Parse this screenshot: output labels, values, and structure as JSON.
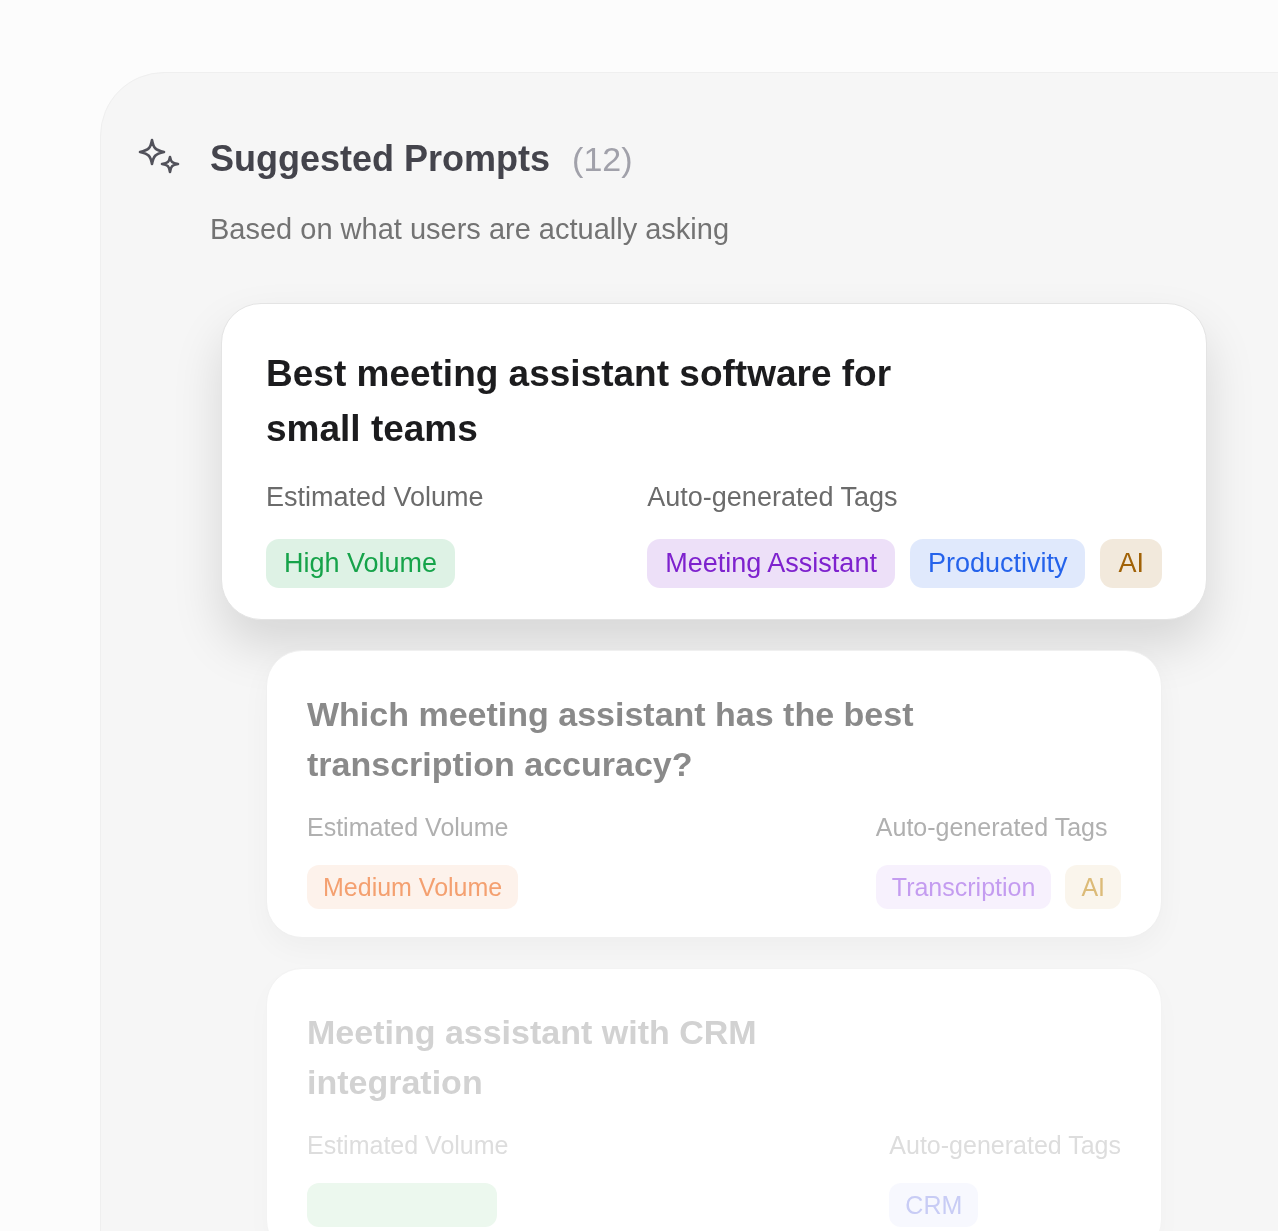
{
  "panel": {
    "title": "Suggested Prompts",
    "count": "(12)",
    "subtitle": "Based on what users are actually asking"
  },
  "prompts": [
    {
      "title": "Best meeting assistant software for small teams",
      "selected": true,
      "volume_label": "Estimated Volume",
      "volume": {
        "text": "High Volume",
        "color": "#16a34a"
      },
      "tags_label": "Auto-generated Tags",
      "tags": [
        {
          "text": "Meeting Assistant",
          "color": "#7e22ce"
        },
        {
          "text": "Productivity",
          "color": "#2563eb"
        },
        {
          "text": "AI",
          "color": "#a16207"
        }
      ]
    },
    {
      "title": "Which meeting assistant has the best transcription accuracy?",
      "selected": false,
      "volume_label": "Estimated Volume",
      "volume": {
        "text": "Medium Volume",
        "color": "#f4a070"
      },
      "tags_label": "Auto-generated Tags",
      "tags": [
        {
          "text": "Transcription",
          "color": "#c49cf0"
        },
        {
          "text": "AI",
          "color": "#dcbb78"
        }
      ]
    },
    {
      "title": "Meeting assistant with CRM integration",
      "selected": false,
      "volume_label": "Estimated Volume",
      "volume": {
        "color": "#ecf8ee"
      },
      "tags_label": "Auto-generated Tags",
      "tags": [
        {
          "text": "CRM",
          "color": "#c8ccf5"
        }
      ]
    }
  ]
}
